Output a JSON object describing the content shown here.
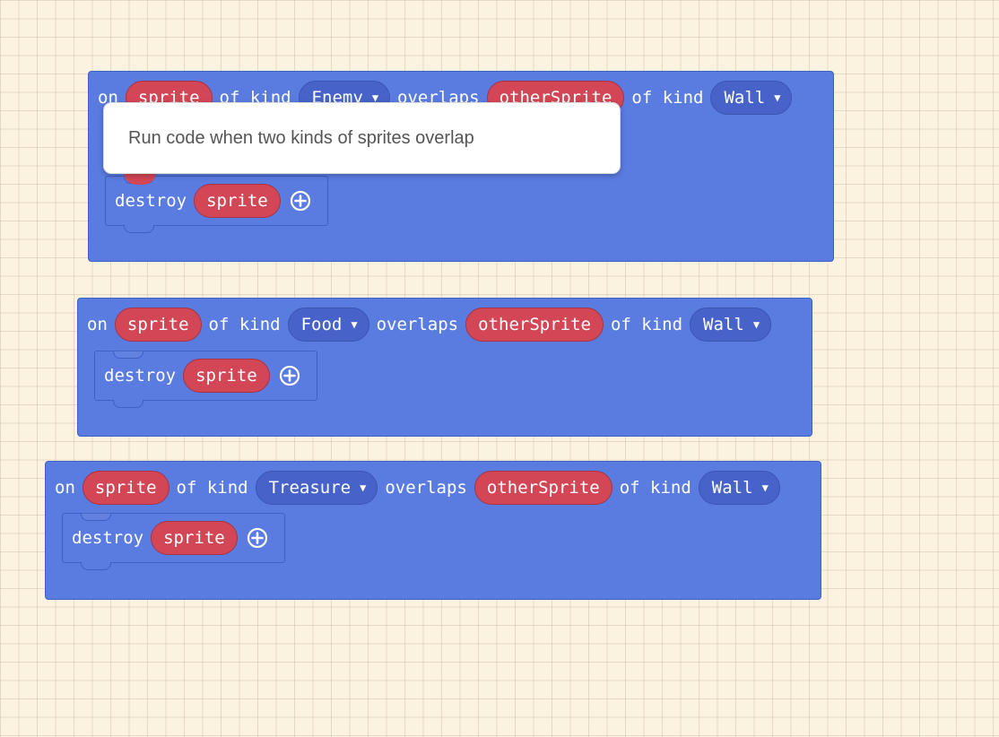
{
  "tooltip": {
    "text": "Run code when two kinds of sprites overlap"
  },
  "common": {
    "on_label": "on",
    "of_kind_label": "of kind",
    "overlaps_label": "overlaps",
    "sprite_var": "sprite",
    "other_sprite_var": "otherSprite",
    "destroy_label": "destroy",
    "caret": "▼"
  },
  "blocks": [
    {
      "kind1": "Enemy",
      "kind2": "Wall"
    },
    {
      "kind1": "Food",
      "kind2": "Wall"
    },
    {
      "kind1": "Treasure",
      "kind2": "Wall"
    }
  ],
  "colors": {
    "event_block": "#5a7be0",
    "variable_pill": "#d34656",
    "dropdown": "#4763c9",
    "workspace_bg": "#fcf2e0"
  },
  "icons": {
    "add": "plus-circle-icon",
    "dropdown": "caret-down-icon"
  }
}
